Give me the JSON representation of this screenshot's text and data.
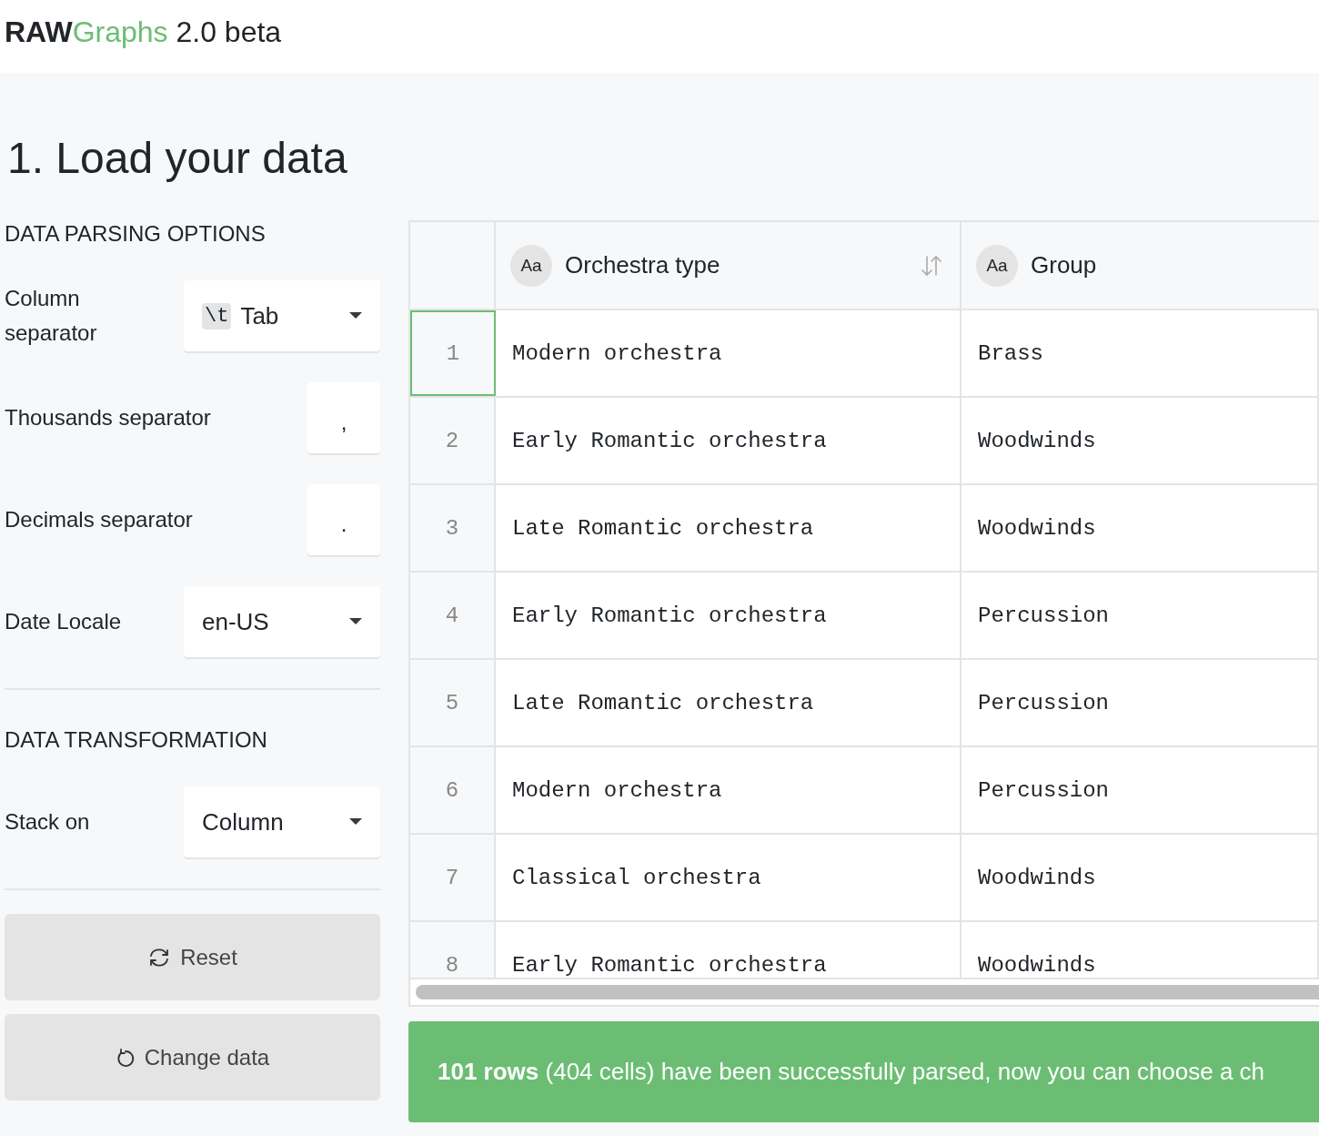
{
  "app": {
    "logo_bold": "RAW",
    "logo_accent": "Graphs",
    "version": "2.0 beta"
  },
  "page_title": "1. Load your data",
  "parsing": {
    "heading": "DATA PARSING OPTIONS",
    "options": [
      {
        "kind": "dropdown",
        "label": "Column separator",
        "badge": "\\t",
        "value": "Tab"
      },
      {
        "kind": "text",
        "label": "Thousands separator",
        "value": ","
      },
      {
        "kind": "text",
        "label": "Decimals separator",
        "value": "."
      },
      {
        "kind": "dropdown",
        "label": "Date Locale",
        "value": "en-US"
      }
    ]
  },
  "transformation": {
    "heading": "DATA TRANSFORMATION",
    "options": [
      {
        "kind": "dropdown",
        "label": "Stack on",
        "value": "Column"
      }
    ]
  },
  "buttons": [
    {
      "kind": "reset",
      "label": "Reset"
    },
    {
      "kind": "change",
      "label": "Change data"
    }
  ],
  "table": {
    "columns": [
      {
        "type_badge": "Aa",
        "name": "Orchestra type",
        "sort_icon": true
      },
      {
        "type_badge": "Aa",
        "name": "Group",
        "sort_icon": false
      }
    ],
    "rows": [
      {
        "index": "1",
        "selected": true,
        "cells": [
          "Modern orchestra",
          "Brass"
        ]
      },
      {
        "index": "2",
        "selected": false,
        "cells": [
          "Early Romantic orchestra",
          "Woodwinds"
        ]
      },
      {
        "index": "3",
        "selected": false,
        "cells": [
          "Late Romantic orchestra",
          "Woodwinds"
        ]
      },
      {
        "index": "4",
        "selected": false,
        "cells": [
          "Early Romantic orchestra",
          "Percussion"
        ]
      },
      {
        "index": "5",
        "selected": false,
        "cells": [
          "Late Romantic orchestra",
          "Percussion"
        ]
      },
      {
        "index": "6",
        "selected": false,
        "cells": [
          "Modern orchestra",
          "Percussion"
        ]
      },
      {
        "index": "7",
        "selected": false,
        "cells": [
          "Classical orchestra",
          "Woodwinds"
        ]
      },
      {
        "index": "8",
        "selected": false,
        "cells": [
          "Early Romantic orchestra",
          "Woodwinds"
        ]
      }
    ]
  },
  "status": {
    "message": "**101 rows** (404 cells) have been successfully parsed, now you can choose a ch"
  }
}
